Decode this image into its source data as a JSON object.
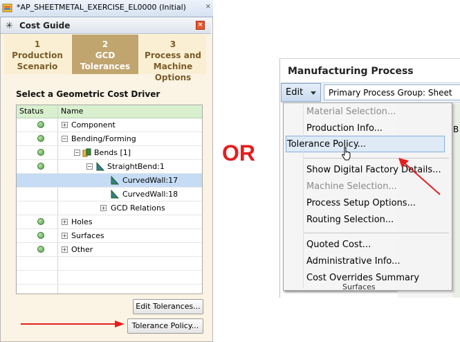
{
  "window": {
    "title": "*AP_SHEETMETAL_EXERCISE_EL0000 (Initial)",
    "tab_close": "×"
  },
  "cost_guide": {
    "title": "Cost Guide",
    "close": "×",
    "steps": [
      {
        "num": "1",
        "label1": "Production",
        "label2": "Scenario",
        "active": false
      },
      {
        "num": "2",
        "label1": "GCD",
        "label2": "Tolerances",
        "active": true
      },
      {
        "num": "3",
        "label1": "Process and",
        "label2": "Machine Options",
        "active": false
      }
    ],
    "section_title": "Select a Geometric Cost Driver",
    "columns": {
      "status": "Status",
      "name": "Name"
    },
    "rows": [
      {
        "name": "Component",
        "status": true,
        "expander": "+"
      },
      {
        "name": "Bending/Forming",
        "status": true,
        "expander": "−"
      },
      {
        "name": "Bends [1]",
        "status": true,
        "expander": "−"
      },
      {
        "name": "StraightBend:1",
        "status": true,
        "expander": "−"
      },
      {
        "name": "CurvedWall:17",
        "status": false,
        "selected": true
      },
      {
        "name": "CurvedWall:18",
        "status": false
      },
      {
        "name": "GCD Relations",
        "status": false,
        "expander": "+"
      },
      {
        "name": "Holes",
        "status": true,
        "expander": "+"
      },
      {
        "name": "Surfaces",
        "status": true,
        "expander": "+"
      },
      {
        "name": "Other",
        "status": true,
        "expander": "+"
      }
    ],
    "buttons": {
      "edit_tolerances": "Edit Tolerances...",
      "tolerance_policy": "Tolerance Policy..."
    }
  },
  "or_label": "OR",
  "manufacturing": {
    "title": "Manufacturing Process",
    "edit_label": "Edit",
    "process_group": "Primary Process Group: Sheet",
    "peek_text": "B",
    "peek_surfaces": "Surfaces",
    "menu": [
      {
        "label": "Material Selection...",
        "disabled": true
      },
      {
        "label": "Production Info...",
        "disabled": false
      },
      {
        "label": "Tolerance Policy...",
        "disabled": false,
        "highlighted": true
      },
      {
        "label": "Show Digital Factory Details...",
        "disabled": false
      },
      {
        "label": "Machine Selection...",
        "disabled": true
      },
      {
        "label": "Process Setup Options...",
        "disabled": false
      },
      {
        "label": "Routing Selection...",
        "disabled": false
      },
      {
        "label": "Quoted Cost...",
        "disabled": false
      },
      {
        "label": "Administrative Info...",
        "disabled": false
      },
      {
        "label": "Cost Overrides Summary",
        "disabled": false
      }
    ]
  },
  "colors": {
    "accent_red": "#e41e1e",
    "step_active": "#c1a56f",
    "grid_header": "#d9f0cf",
    "selection": "#c6dcf4"
  }
}
